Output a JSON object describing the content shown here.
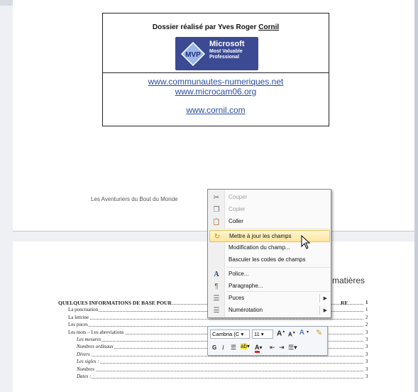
{
  "cover": {
    "author_prefix": "Dossier réalisé par Yves Roger ",
    "author_name": "Cornil",
    "logo_text": [
      "Microsoft",
      "Most Valuable",
      "Professional"
    ],
    "logo_abbrev": "MVP",
    "links": [
      "www.communautes-numeriques.net",
      "www.microcam06.org",
      "www.cornil.com"
    ],
    "footer": "Les Aventuriers du Bout du Monde"
  },
  "toc": {
    "title": "matières",
    "entries": [
      {
        "label": "QUELQUES INFORMATIONS DE BASE POUR",
        "suffix": "RE",
        "page": "1",
        "level": 1
      },
      {
        "label": "La ponctuation",
        "page": "1",
        "level": 2
      },
      {
        "label": "La lettrine",
        "page": "2",
        "level": 2
      },
      {
        "label": "Les puces",
        "page": "2",
        "level": 2
      },
      {
        "label": "Les mots – Les abreviations",
        "page": "3",
        "level": 2
      },
      {
        "label": "Les mesures",
        "page": "3",
        "level": 3
      },
      {
        "label": "Nombres ordinaux",
        "page": "3",
        "level": 3
      },
      {
        "label": "Divers",
        "page": "3",
        "level": 3
      },
      {
        "label": "Les sigles :",
        "page": "3",
        "level": 3
      },
      {
        "label": "Nombres",
        "page": "3",
        "level": 3
      },
      {
        "label": "Dates :",
        "page": "3",
        "level": 3
      }
    ]
  },
  "context_menu": {
    "items": [
      {
        "label": "Couper",
        "icon": "scissors-icon",
        "glyph": "✂",
        "disabled": true
      },
      {
        "label": "Copier",
        "icon": "copy-icon",
        "glyph": "❐",
        "disabled": true
      },
      {
        "label": "Coller",
        "icon": "paste-icon",
        "glyph": "📋",
        "disabled": false
      },
      {
        "label": "Mettre à jour les champs",
        "icon": "update-fields-icon",
        "glyph": "↻",
        "disabled": false,
        "highlighted": true
      },
      {
        "label": "Modification du champ...",
        "icon": "",
        "glyph": "",
        "disabled": false
      },
      {
        "label": "Basculer les codes de champs",
        "icon": "",
        "glyph": "",
        "disabled": false
      },
      {
        "label": "Police...",
        "icon": "font-icon",
        "glyph": "A",
        "disabled": false
      },
      {
        "label": "Paragraphe...",
        "icon": "paragraph-icon",
        "glyph": "¶",
        "disabled": false
      },
      {
        "label": "Puces",
        "icon": "bullets-icon",
        "glyph": "☰",
        "disabled": false,
        "submenu": true
      },
      {
        "label": "Numérotation",
        "icon": "numbering-icon",
        "glyph": "☰",
        "disabled": false,
        "submenu": true
      }
    ]
  },
  "mini_toolbar": {
    "font_name": "Cambria (C",
    "font_size": "11",
    "grow_font": "A",
    "shrink_font": "A",
    "bold": "G",
    "italic": "I",
    "font_color_letter": "A"
  }
}
